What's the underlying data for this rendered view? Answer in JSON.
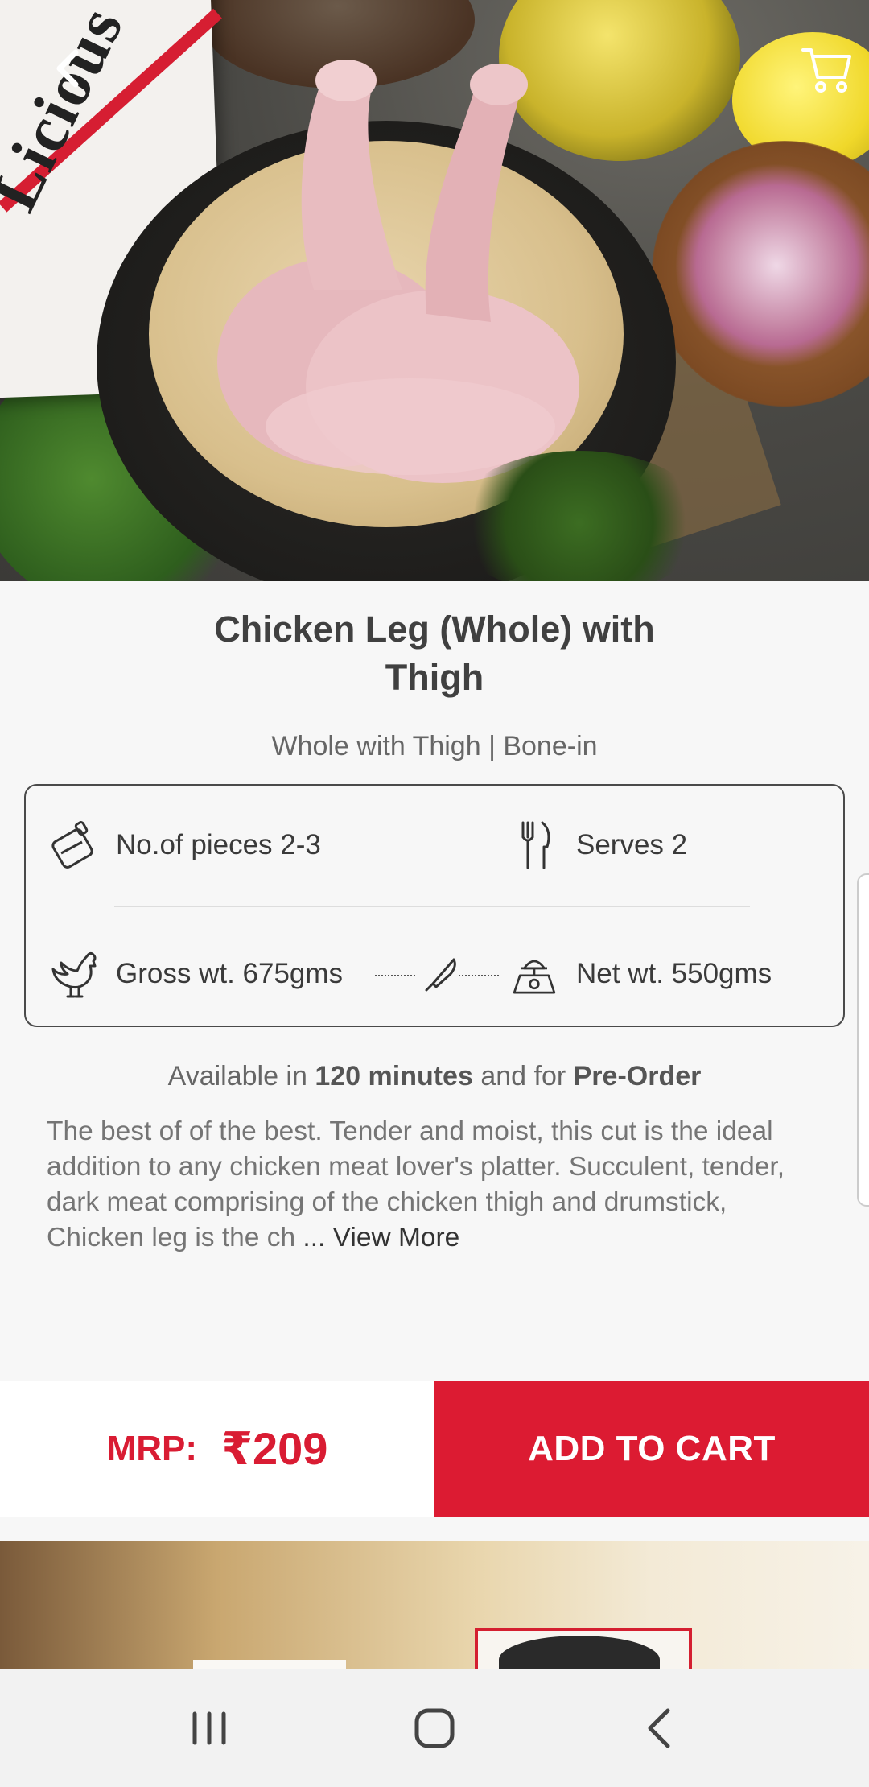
{
  "hero": {
    "box_brand": "Licious"
  },
  "product": {
    "title_line1": "Chicken Leg (Whole) with",
    "title_line2": "Thigh",
    "subtitle": "Whole with Thigh | Bone-in"
  },
  "info": {
    "pieces": "No.of pieces 2-3",
    "serves": "Serves 2",
    "gross": "Gross wt. 675gms",
    "net": "Net wt. 550gms"
  },
  "availability": {
    "prefix": "Available in ",
    "time": "120 minutes",
    "middle": " and for ",
    "mode": "Pre-Order"
  },
  "description": {
    "text": "The best of of the best. Tender and moist, this cut is the ideal addition to any chicken meat lover's platter. Succulent, tender, dark meat comprising of the chicken thigh and drumstick, Chicken leg is the ch",
    "more": " ... View More"
  },
  "buy": {
    "mrp_label": "MRP:",
    "price": "₹209",
    "add_to_cart": "ADD TO CART"
  },
  "colors": {
    "brand_red": "#dc1b32",
    "text_dark": "#404040",
    "text_muted": "#757575"
  },
  "icons": {
    "back": "chevron-left-icon",
    "cart": "cart-icon",
    "pieces": "cutting-board-icon",
    "serves": "fork-knife-icon",
    "gross": "rooster-icon",
    "knife": "knife-icon",
    "net": "weighing-scale-icon",
    "nav_recents": "recents-icon",
    "nav_home": "home-icon",
    "nav_back": "back-icon"
  }
}
